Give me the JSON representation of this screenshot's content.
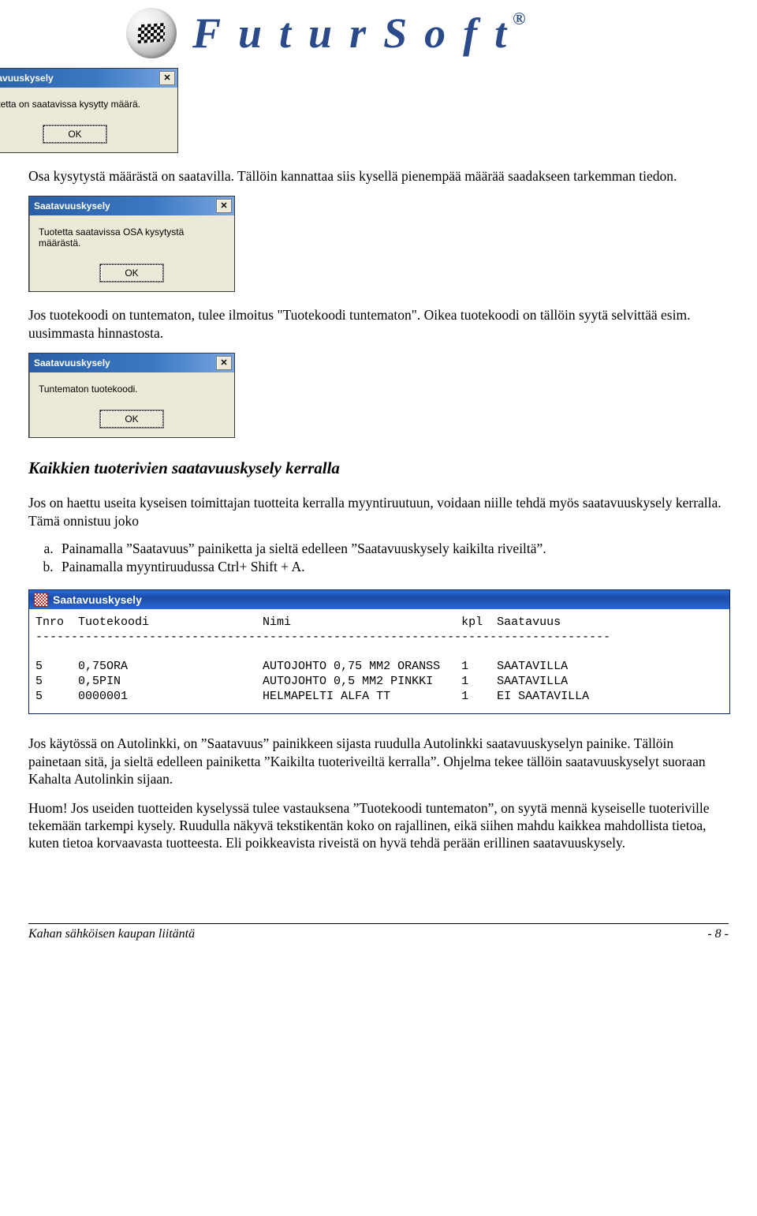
{
  "brand": {
    "name": "FuturSoft",
    "reg_mark": "®"
  },
  "dialogs": {
    "d1": {
      "title": "Saatavuuskysely",
      "message": "Tuotetta on saatavissa kysytty määrä.",
      "ok": "OK"
    },
    "d2": {
      "title": "Saatavuuskysely",
      "message": "Tuotetta saatavissa OSA kysytystä määrästä.",
      "ok": "OK"
    },
    "d3": {
      "title": "Saatavuuskysely",
      "message": "Tuntematon tuotekoodi.",
      "ok": "OK"
    }
  },
  "body_text": {
    "intro1": "Osa kysytystä määrästä on saatavilla. Tällöin kannattaa siis kysellä pienempää määrää saadakseen tarkemman tiedon.",
    "intro2a": "Jos tuotekoodi on tuntematon, tulee ilmoitus \"Tuotekoodi tuntematon\". Oikea tuotekoodi on tällöin syytä selvittää esim. uusimmasta hinnastosta.",
    "section_heading": "Kaikkien tuoterivien saatavuuskysely kerralla",
    "section_para": "Jos on haettu useita kyseisen toimittajan tuotteita kerralla myyntiruutuun, voidaan niille tehdä myös saatavuuskysely kerralla. Tämä onnistuu joko",
    "li_a": "Painamalla ”Saatavuus” painiketta ja sieltä edelleen ”Saatavuuskysely kaikilta riveiltä”.",
    "li_b": "Painamalla myyntiruudussa Ctrl+ Shift + A.",
    "after1": "Jos käytössä on Autolinkki, on ”Saatavuus” painikkeen sijasta ruudulla Autolinkki saatavuuskyselyn painike. Tällöin painetaan sitä, ja sieltä edelleen painiketta ”Kaikilta tuoteriveiltä kerralla”. Ohjelma tekee tällöin saatavuuskyselyt suoraan Kahalta Autolinkin sijaan.",
    "after2": "Huom! Jos useiden tuotteiden kyselyssä tulee vastauksena ”Tuotekoodi tuntematon”, on syytä mennä kyseiselle tuoteriville tekemään tarkempi kysely. Ruudulla näkyvä tekstikentän koko on rajallinen, eikä siihen mahdu kaikkea mahdollista tietoa, kuten tietoa korvaavasta tuotteesta. Eli poikkeavista riveistä on hyvä tehdä perään erillinen saatavuuskysely."
  },
  "result_window": {
    "title": "Saatavuuskysely",
    "header": "Tnro  Tuotekoodi                Nimi                        kpl  Saatavuus",
    "divider": "---------------------------------------------------------------------------------",
    "rows": [
      "5     0,75ORA                   AUTOJOHTO 0,75 MM2 ORANSS   1    SAATAVILLA",
      "5     0,5PIN                    AUTOJOHTO 0,5 MM2 PINKKI    1    SAATAVILLA",
      "5     0000001                   HELMAPELTI ALFA TT          1    EI SAATAVILLA"
    ]
  },
  "footer": {
    "left": "Kahan sähköisen kaupan liitäntä",
    "right": "- 8 -"
  }
}
